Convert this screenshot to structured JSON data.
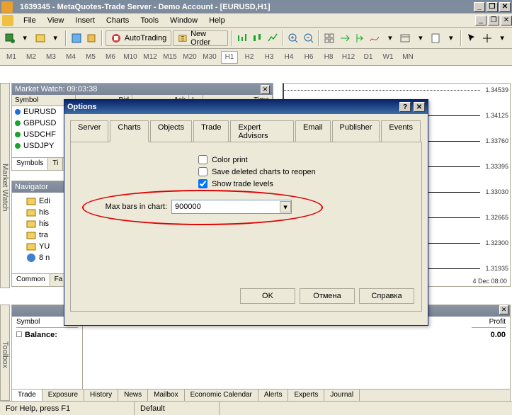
{
  "window": {
    "title": "1639345 - MetaQuotes-Trade Server - Demo Account - [EURUSD,H1]"
  },
  "menu": {
    "items": [
      "File",
      "View",
      "Insert",
      "Charts",
      "Tools",
      "Window",
      "Help"
    ]
  },
  "toolbar": {
    "autotrading": "AutoTrading",
    "neworder": "New Order"
  },
  "timeframes": {
    "items": [
      "M1",
      "M2",
      "M3",
      "M4",
      "M5",
      "M6",
      "M10",
      "M12",
      "M15",
      "M20",
      "M30",
      "H1",
      "H2",
      "H3",
      "H4",
      "H6",
      "H8",
      "H12",
      "D1",
      "W1",
      "MN"
    ],
    "active": "H1"
  },
  "market_watch": {
    "title": "Market Watch: 09:03:38",
    "cols": [
      "Symbol",
      "Bid",
      "Ask",
      "!",
      "Time"
    ],
    "rows": [
      {
        "sym": "EURUSD",
        "color": "#1b6fd4"
      },
      {
        "sym": "GBPUSD",
        "color": "#1aa32a"
      },
      {
        "sym": "USDCHF",
        "color": "#1aa32a"
      },
      {
        "sym": "USDJPY",
        "color": "#1aa32a"
      }
    ],
    "tabs": [
      "Symbols",
      "Ti"
    ]
  },
  "navigator": {
    "title": "Navigator",
    "rows": [
      "Edi",
      "his",
      "his",
      "tra",
      "YU",
      "8 n"
    ],
    "tabs": [
      "Common",
      "Fa"
    ]
  },
  "chart": {
    "yticks": [
      "1.34539",
      "1.34125",
      "1.33760",
      "1.33395",
      "1.33030",
      "1.32665",
      "1.32300",
      "1.31935"
    ],
    "xlabel": "4 Dec 08:00"
  },
  "toolbox": {
    "cols": [
      "Symbol"
    ],
    "balance_label": "Balance:",
    "profit_label": "Profit",
    "profit_value": "0.00",
    "tabs": [
      "Trade",
      "Exposure",
      "History",
      "News",
      "Mailbox",
      "Economic Calendar",
      "Alerts",
      "Experts",
      "Journal"
    ]
  },
  "status": {
    "help": "For Help, press F1",
    "profile": "Default"
  },
  "dialog": {
    "title": "Options",
    "tabs": [
      "Server",
      "Charts",
      "Objects",
      "Trade",
      "Expert Advisors",
      "Email",
      "Publisher",
      "Events"
    ],
    "active_tab": "Charts",
    "color_print": "Color print",
    "save_deleted": "Save deleted charts to reopen",
    "show_trade": "Show trade levels",
    "show_trade_checked": true,
    "maxbars_label": "Max bars in chart:",
    "maxbars_value": "900000",
    "ok": "OK",
    "cancel": "Отмена",
    "help": "Справка"
  },
  "sidelabels": {
    "mw": "Market Watch",
    "nav": "Navigator",
    "tbx": "Toolbox"
  }
}
